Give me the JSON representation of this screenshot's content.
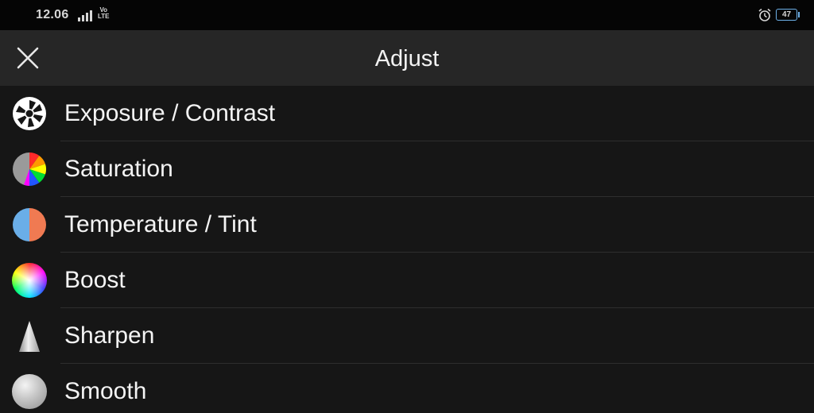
{
  "status_bar": {
    "time": "12.06",
    "network_top": "Vo",
    "network_bottom": "LTE",
    "battery": "47",
    "icons": [
      "signal-icon",
      "alarm-icon",
      "battery-icon"
    ]
  },
  "toolbar": {
    "title": "Adjust",
    "close_icon": "close-icon"
  },
  "menu": {
    "items": [
      {
        "label": "Exposure / Contrast",
        "icon": "aperture-icon"
      },
      {
        "label": "Saturation",
        "icon": "color-pie-icon"
      },
      {
        "label": "Temperature / Tint",
        "icon": "temperature-tint-icon"
      },
      {
        "label": "Boost",
        "icon": "color-wheel-icon"
      },
      {
        "label": "Sharpen",
        "icon": "cone-icon"
      },
      {
        "label": "Smooth",
        "icon": "sphere-icon"
      }
    ]
  },
  "colors": {
    "background": "#161616",
    "status_bar": "#050505",
    "toolbar": "#262626",
    "text": "#f4f4f4",
    "divider": "#2e2e2e",
    "temperature_blue": "#6aaee8",
    "tint_orange": "#f07a52"
  }
}
